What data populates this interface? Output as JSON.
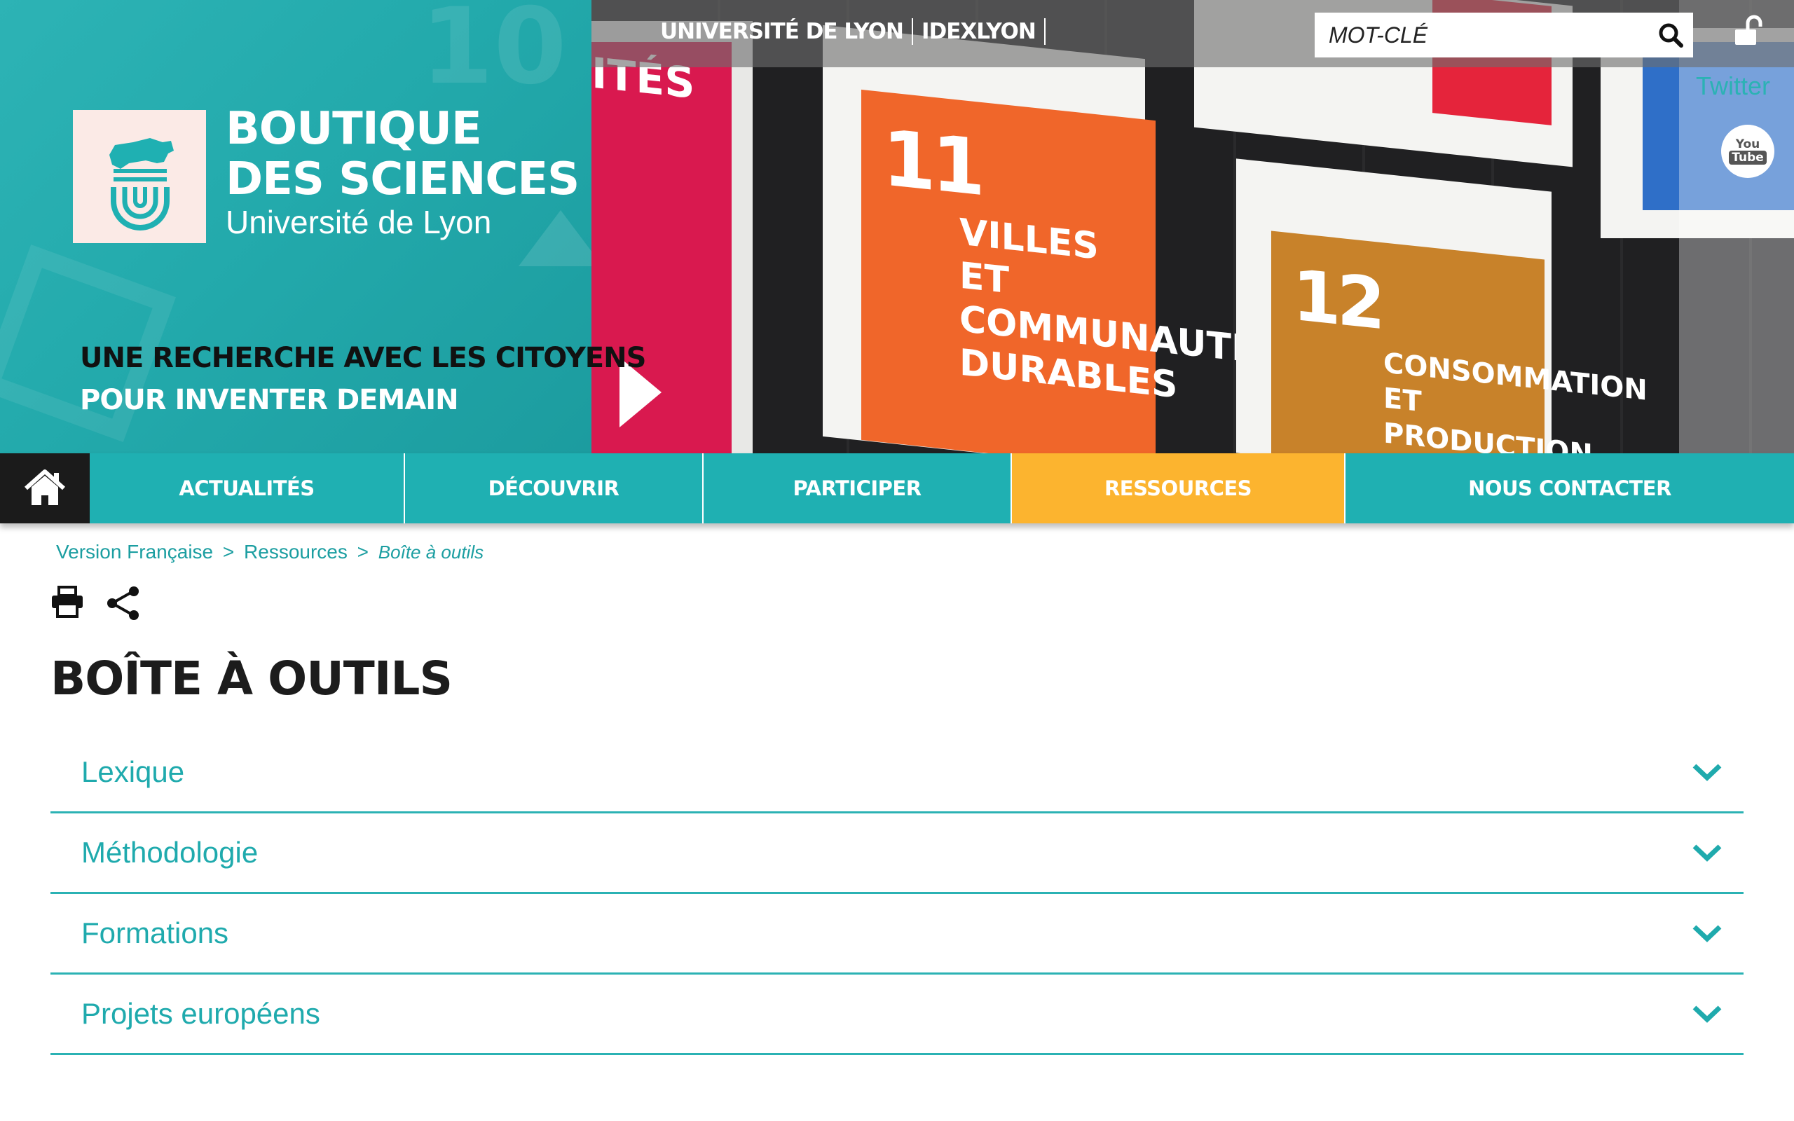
{
  "site": {
    "title_line1": "BOUTIQUE",
    "title_line2": "DES SCIENCES",
    "subtitle": "Université de Lyon",
    "tagline_line1": "UNE RECHERCHE AVEC LES CITOYENS",
    "tagline_line2": "POUR INVENTER DEMAIN"
  },
  "top_links": [
    "UNIVERSITÉ DE LYON",
    "IDEXLYON"
  ],
  "search": {
    "placeholder": "MOT-CLÉ"
  },
  "social": {
    "twitter": "Twitter",
    "youtube_top": "You",
    "youtube_bottom": "Tube"
  },
  "hero_cards": {
    "card11_number": "11",
    "card11_text": "VILLES ET COMMUNAUTÉS DURABLES",
    "card12_number": "12",
    "card12_text": "CONSOMMATION ET PRODUCTION",
    "left_card_text": "ITÉS"
  },
  "nav": {
    "items": [
      "ACTUALITÉS",
      "DÉCOUVRIR",
      "PARTICIPER",
      "RESSOURCES",
      "NOUS CONTACTER"
    ],
    "active": "RESSOURCES"
  },
  "breadcrumb": {
    "items": [
      "Version Française",
      "Ressources"
    ],
    "current": "Boîte à outils",
    "separator": ">"
  },
  "page": {
    "title": "BOÎTE À OUTILS"
  },
  "accordion": [
    "Lexique",
    "Méthodologie",
    "Formations",
    "Projets européens"
  ],
  "colors": {
    "teal": "#1fb0b2",
    "orange": "#fcb42f",
    "dark": "#1b1b1b",
    "sdg11": "#f0662a",
    "sdg12": "#c8822a",
    "sdg10": "#d9194f",
    "sdg_blue": "#2f6fc8"
  }
}
